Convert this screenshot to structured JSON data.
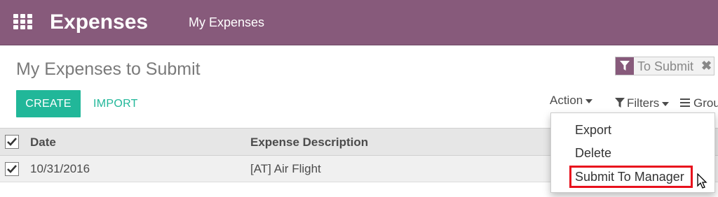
{
  "header": {
    "app_title": "Expenses",
    "menu_item": "My Expenses",
    "brand_color": "#875a7b"
  },
  "page": {
    "title": "My Expenses to Submit"
  },
  "search": {
    "facet_label": "To Submit",
    "facet_remove": "✖"
  },
  "toolbar": {
    "create_label": "CREATE",
    "import_label": "IMPORT",
    "action_label": "Action",
    "filters_label": "Filters",
    "group_label": "Group By",
    "accent_color": "#21b799"
  },
  "table": {
    "columns": [
      "Date",
      "Expense Description"
    ],
    "rows": [
      {
        "date": "10/31/2016",
        "description": "[AT] Air Flight",
        "selected": true
      }
    ],
    "all_selected": true
  },
  "action_menu": {
    "items": [
      "Export",
      "Delete",
      "Submit To Manager"
    ],
    "highlighted": "Submit To Manager",
    "highlight_color": "#e8101c"
  }
}
